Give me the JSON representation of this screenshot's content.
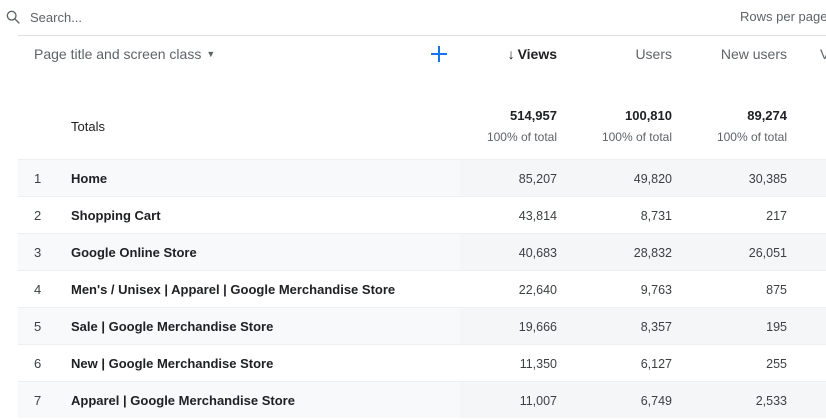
{
  "search": {
    "placeholder": "Search...",
    "value": ""
  },
  "pagination": {
    "rows_per_page_label": "Rows per page"
  },
  "header": {
    "dimension_label": "Page title and screen class",
    "add_icon": "plus-icon",
    "columns": [
      {
        "label": "Views",
        "sorted": true,
        "sort_direction": "descending"
      },
      {
        "label": "Users",
        "sorted": false
      },
      {
        "label": "New users",
        "sorted": false
      },
      {
        "label": "V",
        "sorted": false
      }
    ]
  },
  "totals": {
    "label": "Totals",
    "views": {
      "value": "514,957",
      "pct": "100% of total"
    },
    "users": {
      "value": "100,810",
      "pct": "100% of total"
    },
    "new_users": {
      "value": "89,274",
      "pct": "100% of total"
    }
  },
  "rows": [
    {
      "index": "1",
      "title": "Home",
      "views": "85,207",
      "users": "49,820",
      "new_users": "30,385"
    },
    {
      "index": "2",
      "title": "Shopping Cart",
      "views": "43,814",
      "users": "8,731",
      "new_users": "217"
    },
    {
      "index": "3",
      "title": "Google Online Store",
      "views": "40,683",
      "users": "28,832",
      "new_users": "26,051"
    },
    {
      "index": "4",
      "title": "Men's / Unisex | Apparel | Google Merchandise Store",
      "views": "22,640",
      "users": "9,763",
      "new_users": "875"
    },
    {
      "index": "5",
      "title": "Sale | Google Merchandise Store",
      "views": "19,666",
      "users": "8,357",
      "new_users": "195"
    },
    {
      "index": "6",
      "title": "New | Google Merchandise Store",
      "views": "11,350",
      "users": "6,127",
      "new_users": "255"
    },
    {
      "index": "7",
      "title": "Apparel | Google Merchandise Store",
      "views": "11,007",
      "users": "6,749",
      "new_users": "2,533"
    }
  ],
  "colors": {
    "accent": "#1a73e8",
    "row_alt": "#f8f9fa",
    "divider": "#e0e0e0"
  }
}
